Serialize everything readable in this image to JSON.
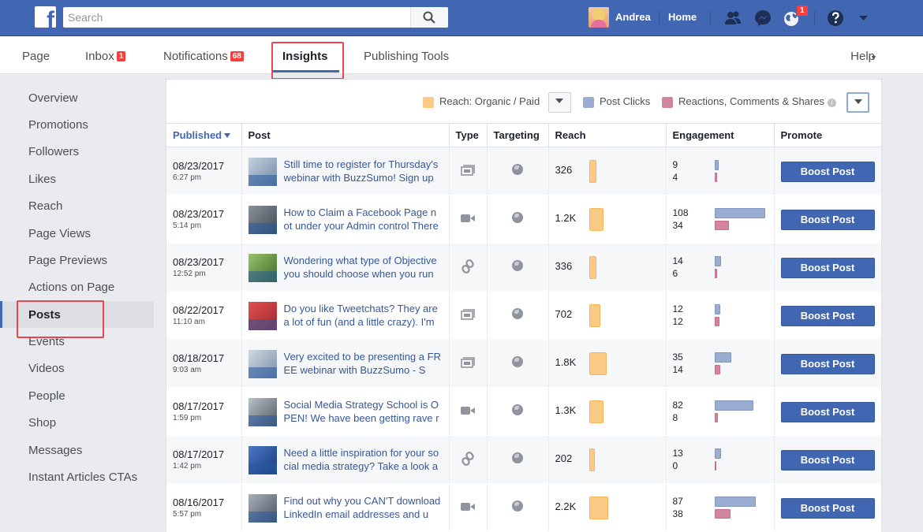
{
  "topbar": {
    "search_placeholder": "Search",
    "user_name": "Andrea",
    "home_label": "Home",
    "notifications_badge": "1"
  },
  "tabs": [
    {
      "label": "Page"
    },
    {
      "label": "Inbox",
      "badge": "1"
    },
    {
      "label": "Notifications",
      "badge": "68"
    },
    {
      "label": "Insights"
    },
    {
      "label": "Publishing Tools"
    }
  ],
  "help_label": "Help",
  "sidebar": {
    "items": [
      "Overview",
      "Promotions",
      "Followers",
      "Likes",
      "Reach",
      "Page Views",
      "Page Previews",
      "Actions on Page",
      "Posts",
      "Events",
      "Videos",
      "People",
      "Shop",
      "Messages",
      "Instant Articles CTAs"
    ]
  },
  "legend": {
    "reach": "Reach: Organic / Paid",
    "clicks": "Post Clicks",
    "reactions": "Reactions, Comments & Shares",
    "colors": {
      "reach": "#fbcb86",
      "clicks": "#9aaccf",
      "reactions": "#d2869e"
    }
  },
  "table": {
    "headers": [
      "Published",
      "Post",
      "Type",
      "Targeting",
      "Reach",
      "Engagement",
      "Promote"
    ],
    "boost_label": "Boost Post",
    "rows": [
      {
        "date": "08/23/2017",
        "time": "6:27 pm",
        "post": "Still time to register for Thursday's webinar with BuzzSumo! Sign up",
        "type": "album-icon",
        "reach": "326",
        "reach_level": 326,
        "eng1": "9",
        "eng2": "4"
      },
      {
        "date": "08/23/2017",
        "time": "5:14 pm",
        "post": "How to Claim a Facebook Page not under your Admin control There",
        "type": "video-icon",
        "reach": "1.2K",
        "reach_level": 1200,
        "eng1": "108",
        "eng2": "34"
      },
      {
        "date": "08/23/2017",
        "time": "12:52 pm",
        "post": "Wondering what type of Objective you should choose when you run",
        "type": "link-icon",
        "reach": "336",
        "reach_level": 336,
        "eng1": "14",
        "eng2": "6"
      },
      {
        "date": "08/22/2017",
        "time": "11:10 am",
        "post": "Do you like Tweetchats? They are a lot of fun (and a little crazy). I'm",
        "type": "album-icon",
        "reach": "702",
        "reach_level": 702,
        "eng1": "12",
        "eng2": "12"
      },
      {
        "date": "08/18/2017",
        "time": "9:03 am",
        "post": "Very excited to be presenting a FREE webinar with BuzzSumo - S",
        "type": "album-icon",
        "reach": "1.8K",
        "reach_level": 1800,
        "eng1": "35",
        "eng2": "14"
      },
      {
        "date": "08/17/2017",
        "time": "1:59 pm",
        "post": "Social Media Strategy School is OPEN! We have been getting rave r",
        "type": "video-icon",
        "reach": "1.3K",
        "reach_level": 1300,
        "eng1": "82",
        "eng2": "8"
      },
      {
        "date": "08/17/2017",
        "time": "1:42 pm",
        "post": "Need a little inspiration for your social media strategy? Take a look a",
        "type": "link-icon",
        "reach": "202",
        "reach_level": 202,
        "eng1": "13",
        "eng2": "0"
      },
      {
        "date": "08/16/2017",
        "time": "5:57 pm",
        "post": "Find out why you CAN'T download LinkedIn email addresses and u",
        "type": "video-icon",
        "reach": "2.2K",
        "reach_level": 2200,
        "eng1": "87",
        "eng2": "38"
      }
    ]
  }
}
